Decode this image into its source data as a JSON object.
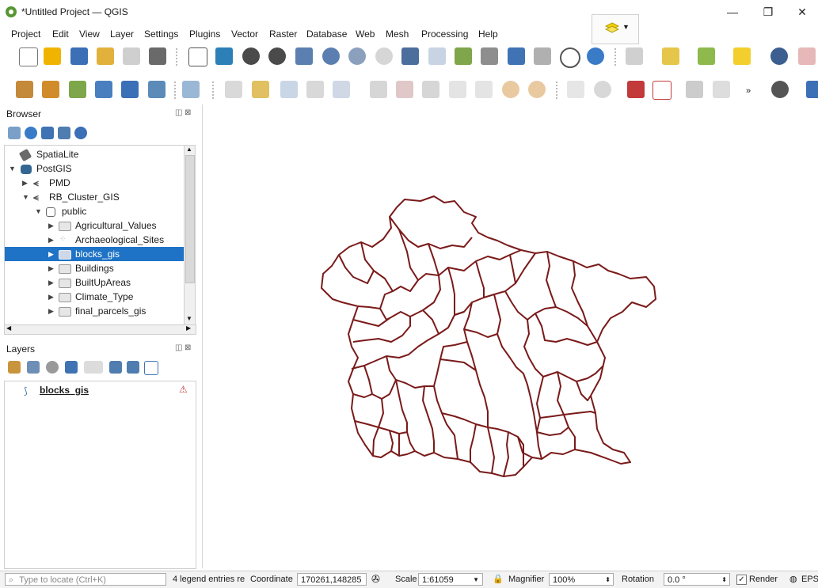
{
  "window": {
    "title": "*Untitled Project — QGIS",
    "minimize_glyph": "—",
    "restore_glyph": "❐",
    "close_glyph": "✕"
  },
  "menubar": [
    "Project",
    "Edit",
    "View",
    "Layer",
    "Settings",
    "Plugins",
    "Vector",
    "Raster",
    "Database",
    "Web",
    "Mesh",
    "Processing",
    "Help"
  ],
  "browser": {
    "title": "Browser",
    "items": [
      {
        "label": "SpatiaLite",
        "icon": "feather-icon"
      },
      {
        "label": "PostGIS",
        "icon": "elephant-icon",
        "expanded": true
      },
      {
        "label": "PMD",
        "icon": "connection-icon"
      },
      {
        "label": "RB_Cluster_GIS",
        "icon": "connection-icon",
        "expanded": true
      },
      {
        "label": "public",
        "icon": "schema-icon",
        "expanded": true
      },
      {
        "label": "Agricultural_Values",
        "icon": "polygon-layer-icon"
      },
      {
        "label": "Archaeological_Sites",
        "icon": "point-layer-icon"
      },
      {
        "label": "blocks_gis",
        "icon": "polygon-layer-icon",
        "selected": true
      },
      {
        "label": "Buildings",
        "icon": "polygon-layer-icon"
      },
      {
        "label": "BuiltUpAreas",
        "icon": "polygon-layer-icon"
      },
      {
        "label": "Climate_Type",
        "icon": "polygon-layer-icon"
      },
      {
        "label": "final_parcels_gis",
        "icon": "polygon-layer-icon"
      }
    ]
  },
  "layers": {
    "title": "Layers",
    "items": [
      {
        "label": "blocks_gis",
        "checked": true,
        "warning": true
      }
    ]
  },
  "statusbar": {
    "locate_placeholder": "Type to locate (Ctrl+K)",
    "legend_msg": "4 legend entries re",
    "coordinate_label": "Coordinate",
    "coordinate_value": "170261,148285",
    "scale_label": "Scale",
    "scale_value": "1:61059",
    "magnifier_label": "Magnifier",
    "magnifier_value": "100%",
    "rotation_label": "Rotation",
    "rotation_value": "0.0 °",
    "render_label": "Render",
    "crs_label": "EPS"
  },
  "colors": {
    "selection": "#1e73c6",
    "map_outline": "#7a1a1a",
    "qgis_green": "#589632"
  }
}
